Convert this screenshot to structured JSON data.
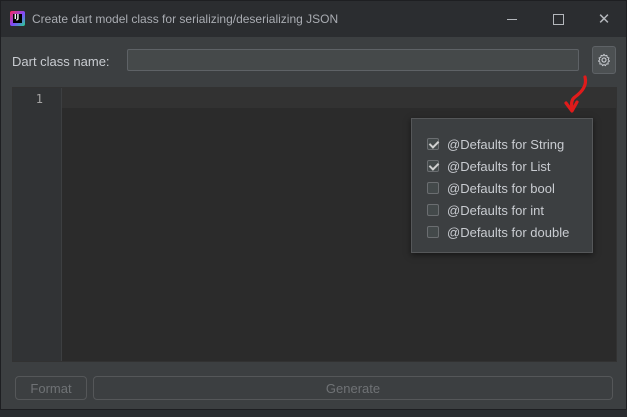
{
  "window": {
    "title": "Create dart model class for serializing/deserializing JSON",
    "app_icon": "intellij-idea-icon"
  },
  "form": {
    "class_name_label": "Dart class name:",
    "class_name_value": "",
    "class_name_placeholder": "",
    "settings_icon": "gear-icon"
  },
  "editor": {
    "line_numbers": [
      "1"
    ],
    "content": ""
  },
  "options_popup": {
    "options": [
      {
        "label": "@Defaults for String",
        "checked": true
      },
      {
        "label": "@Defaults for List",
        "checked": true
      },
      {
        "label": "@Defaults for bool",
        "checked": false
      },
      {
        "label": "@Defaults for int",
        "checked": false
      },
      {
        "label": "@Defaults for double",
        "checked": false
      }
    ]
  },
  "buttons": {
    "format_label": "Format",
    "generate_label": "Generate"
  },
  "colors": {
    "annotation_arrow": "#e01b1b",
    "background": "#3c3f41",
    "editor_background": "#2b2b2b"
  }
}
